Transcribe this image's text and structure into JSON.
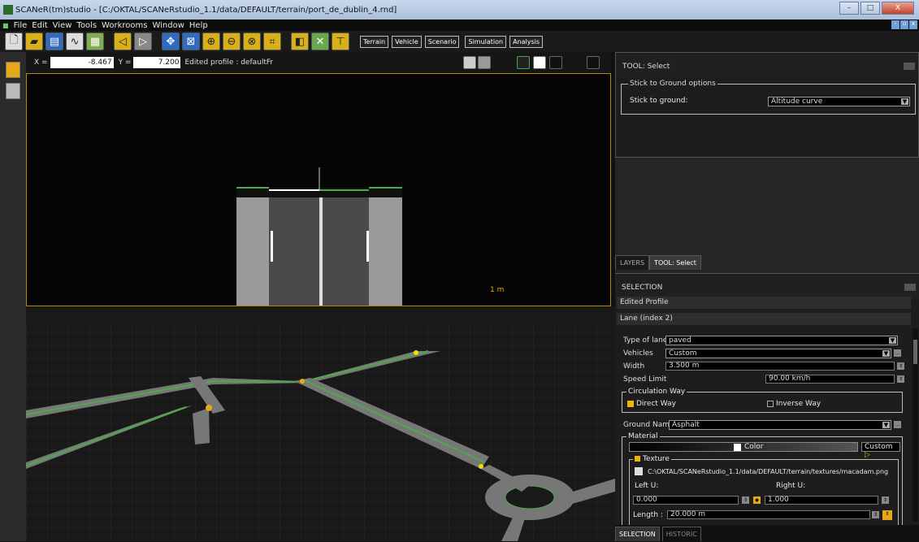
{
  "window": {
    "title": "SCANeR(tm)studio - [C:/OKTAL/SCANeRstudio_1.1/data/DEFAULT/terrain/port_de_dublin_4.rnd]",
    "controls": [
      "–",
      "□",
      "X"
    ]
  },
  "menu": [
    "File",
    "Edit",
    "View",
    "Tools",
    "Workrooms",
    "Window",
    "Help"
  ],
  "toolbar": {
    "tabs": [
      "Terrain",
      "Vehicle",
      "Scenario",
      "Simulation",
      "Analysis"
    ]
  },
  "coords": {
    "x_label": "X =",
    "x_value": "-8.467",
    "y_label": "Y =",
    "y_value": "7.200",
    "profile_label": "Edited profile : defaultFr"
  },
  "profile": {
    "scale_label": "1 m"
  },
  "tool_panel": {
    "title": "TOOL: Select",
    "group_title": "Stick to Ground options",
    "stick_label": "Stick to ground:",
    "stick_value": "Altitude curve"
  },
  "panel_tabs": [
    "LAYERS",
    "TOOL: Select"
  ],
  "selection": {
    "title": "SELECTION",
    "edited_profile": "Edited Profile",
    "lane_header": "Lane (index 2)",
    "type_label": "Type of lane",
    "type_value": "paved",
    "vehicles_label": "Vehicles",
    "vehicles_value": "Custom",
    "width_label": "Width",
    "width_value": "3.500 m",
    "speed_label": "Speed Limit",
    "speed_value": "90.00 km/h",
    "circ_title": "Circulation Way",
    "direct_label": "Direct Way",
    "direct_checked": true,
    "inverse_label": "Inverse Way",
    "inverse_checked": false,
    "ground_label": "Ground Name",
    "ground_value": "Asphalt",
    "material_title": "Material",
    "color_label": "Color",
    "custom_label": "Custom",
    "texture_title": "Texture",
    "texture_path": "C:\\OKTAL/SCANeRstudio_1.1/data/DEFAULT/terrain/textures/macadam.png",
    "left_u_label": "Left U:",
    "left_u_value": "0.000",
    "right_u_label": "Right U:",
    "right_u_value": "1.000",
    "length_label": "Length :",
    "length_value": "20.000 m"
  },
  "bottom_tabs": [
    "SELECTION",
    "HISTORIC"
  ],
  "colors": {
    "accent": "#f1b200",
    "road_edge": "#4ea84e",
    "profile_border": "#b58a00"
  }
}
